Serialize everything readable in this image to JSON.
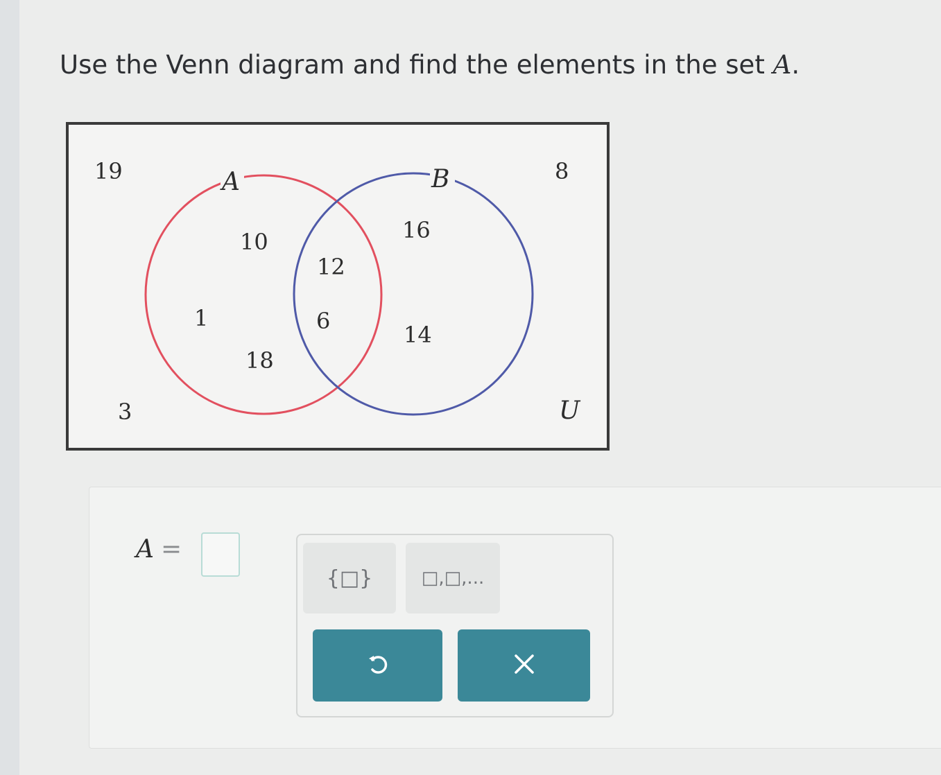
{
  "question": {
    "prefix": "Use the Venn diagram and find the elements in the set ",
    "set_var": "A",
    "suffix": "."
  },
  "venn": {
    "circle_a_label": "A",
    "circle_b_label": "B",
    "universe_label": "U",
    "circle_a_color": "#e2505f",
    "circle_b_color": "#4f5aa8",
    "outside_values": [
      "19",
      "8",
      "3"
    ],
    "a_only_values": [
      "10",
      "1",
      "18"
    ],
    "intersection_values": [
      "12",
      "6"
    ],
    "b_only_values": [
      "16",
      "14"
    ]
  },
  "answer": {
    "set_var": "A",
    "equals": "=",
    "value": ""
  },
  "tools": {
    "set_braces_label": "{□}",
    "list_label": "□,□,..."
  },
  "actions": {
    "undo_icon": "undo-icon",
    "clear_icon": "close-icon"
  },
  "colors": {
    "accent": "#3b8898",
    "input_border": "#b8dcd6"
  }
}
